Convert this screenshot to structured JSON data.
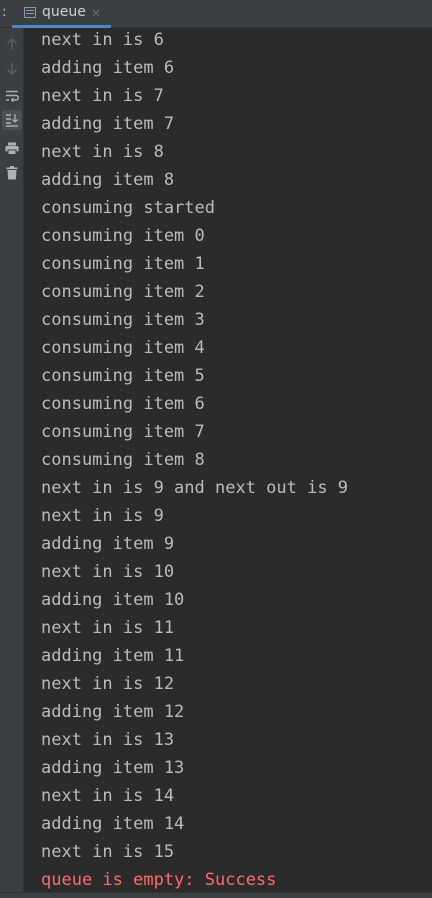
{
  "tabbar": {
    "separator": ":",
    "tab": {
      "label": "queue",
      "close": "×",
      "icon": "console-icon"
    },
    "accent_color": "#4a88c7"
  },
  "toolbar": {
    "items": [
      {
        "name": "scroll-up-icon",
        "state": "disabled"
      },
      {
        "name": "scroll-down-icon",
        "state": "disabled"
      },
      {
        "name": "soft-wrap-icon",
        "state": "enabled"
      },
      {
        "name": "scroll-to-end-icon",
        "state": "active"
      },
      {
        "name": "print-icon",
        "state": "enabled"
      },
      {
        "name": "clear-all-icon",
        "state": "enabled"
      }
    ]
  },
  "console": {
    "text_color": "#bbbbbb",
    "error_color": "#ff6b68",
    "lines": [
      {
        "text": "next in is 6",
        "type": "stdout"
      },
      {
        "text": "adding item 6",
        "type": "stdout"
      },
      {
        "text": "next in is 7",
        "type": "stdout"
      },
      {
        "text": "adding item 7",
        "type": "stdout"
      },
      {
        "text": "next in is 8",
        "type": "stdout"
      },
      {
        "text": "adding item 8",
        "type": "stdout"
      },
      {
        "text": "consuming started",
        "type": "stdout"
      },
      {
        "text": "consuming item 0",
        "type": "stdout"
      },
      {
        "text": "consuming item 1",
        "type": "stdout"
      },
      {
        "text": "consuming item 2",
        "type": "stdout"
      },
      {
        "text": "consuming item 3",
        "type": "stdout"
      },
      {
        "text": "consuming item 4",
        "type": "stdout"
      },
      {
        "text": "consuming item 5",
        "type": "stdout"
      },
      {
        "text": "consuming item 6",
        "type": "stdout"
      },
      {
        "text": "consuming item 7",
        "type": "stdout"
      },
      {
        "text": "consuming item 8",
        "type": "stdout"
      },
      {
        "text": "next in is 9 and next out is 9",
        "type": "stdout"
      },
      {
        "text": "next in is 9",
        "type": "stdout"
      },
      {
        "text": "adding item 9",
        "type": "stdout"
      },
      {
        "text": "next in is 10",
        "type": "stdout"
      },
      {
        "text": "adding item 10",
        "type": "stdout"
      },
      {
        "text": "next in is 11",
        "type": "stdout"
      },
      {
        "text": "adding item 11",
        "type": "stdout"
      },
      {
        "text": "next in is 12",
        "type": "stdout"
      },
      {
        "text": "adding item 12",
        "type": "stdout"
      },
      {
        "text": "next in is 13",
        "type": "stdout"
      },
      {
        "text": "adding item 13",
        "type": "stdout"
      },
      {
        "text": "next in is 14",
        "type": "stdout"
      },
      {
        "text": "adding item 14",
        "type": "stdout"
      },
      {
        "text": "next in is 15",
        "type": "stdout"
      },
      {
        "text": "queue is empty: Success",
        "type": "stderr"
      }
    ]
  }
}
